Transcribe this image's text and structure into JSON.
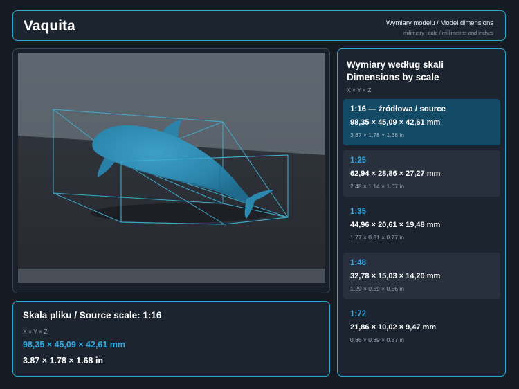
{
  "header": {
    "title": "Vaquita",
    "subtitle": "Wymiary modelu / Model dimensions",
    "units_note": "milimetry i cale / millimetres and inches"
  },
  "source_panel": {
    "title": "Skala pliku / Source scale: 1:16",
    "axes": "X × Y × Z",
    "mm": "98,35 × 45,09 × 42,61 mm",
    "inches": "3.87 × 1.78 × 1.68 in"
  },
  "dims_panel": {
    "title_pl": "Wymiary według skali",
    "title_en": "Dimensions by scale",
    "axes": "X × Y × Z",
    "scales": [
      {
        "label": "1:16  —  źródłowa / source",
        "mm": "98,35 × 45,09 × 42,61 mm",
        "inches": "3.87 × 1.78 × 1.68 in"
      },
      {
        "label": "1:25",
        "mm": "62,94 × 28,86 × 27,27 mm",
        "inches": "2.48 × 1.14 × 1.07 in"
      },
      {
        "label": "1:35",
        "mm": "44,96 × 20,61 × 19,48 mm",
        "inches": "1.77 × 0.81 × 0.77 in"
      },
      {
        "label": "1:48",
        "mm": "32,78 × 15,03 × 14,20 mm",
        "inches": "1.29 × 0.59 × 0.56 in"
      },
      {
        "label": "1:72",
        "mm": "21,86 × 10,02 × 9,47 mm",
        "inches": "0.86 × 0.39 × 0.37 in"
      }
    ]
  },
  "colors": {
    "accent": "#2aa8d4",
    "model": "#2f8fb6",
    "selected_card": "#134a66",
    "background": "#151b23"
  }
}
